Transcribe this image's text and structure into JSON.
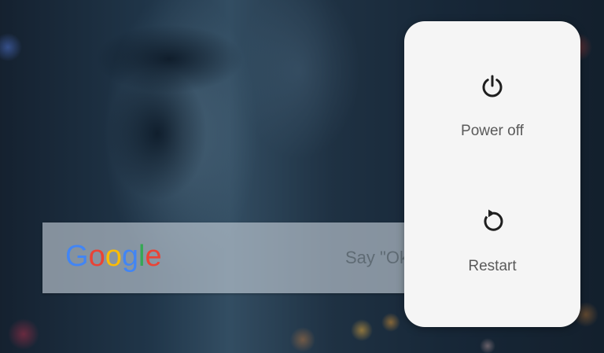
{
  "screen": {
    "background": "blurred-city-night-wallpaper"
  },
  "search_widget": {
    "logo_letters": [
      {
        "char": "G",
        "color": "#4285F4"
      },
      {
        "char": "o",
        "color": "#EA4335"
      },
      {
        "char": "o",
        "color": "#FBBC05"
      },
      {
        "char": "g",
        "color": "#4285F4"
      },
      {
        "char": "l",
        "color": "#34A853"
      },
      {
        "char": "e",
        "color": "#EA4335"
      }
    ],
    "hint_text": "Say \"Ok"
  },
  "power_menu": {
    "items": [
      {
        "label": "Power off",
        "icon": "power-icon"
      },
      {
        "label": "Restart",
        "icon": "restart-icon"
      }
    ],
    "icon_color": "#1f1f1f",
    "label_color": "#5a5a5a",
    "background": "#f5f5f5"
  }
}
